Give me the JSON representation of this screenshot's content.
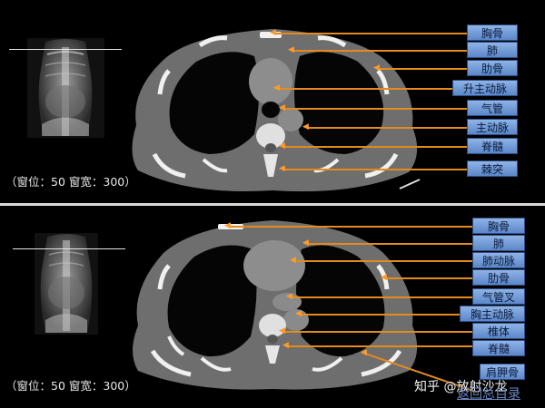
{
  "top_panel": {
    "window_text": "（窗位：50 窗宽：300）",
    "labels": [
      "胸骨",
      "肺",
      "肋骨",
      "升主动脉",
      "气管",
      "主动脉",
      "脊髓",
      "棘突"
    ]
  },
  "bottom_panel": {
    "window_text": "（窗位：50 窗宽：300）",
    "labels": [
      "胸骨",
      "肺",
      "肺动脉",
      "肋骨",
      "气管叉",
      "胸主动脉",
      "椎体",
      "脊髓",
      "肩胛骨"
    ]
  },
  "watermark": {
    "source": "知乎 @放射沙龙",
    "link": "返回总目录"
  },
  "colors": {
    "label_fill": "#6f98d6",
    "label_border": "#2e4f86",
    "leader": "#e58a1f",
    "background": "#000000"
  }
}
